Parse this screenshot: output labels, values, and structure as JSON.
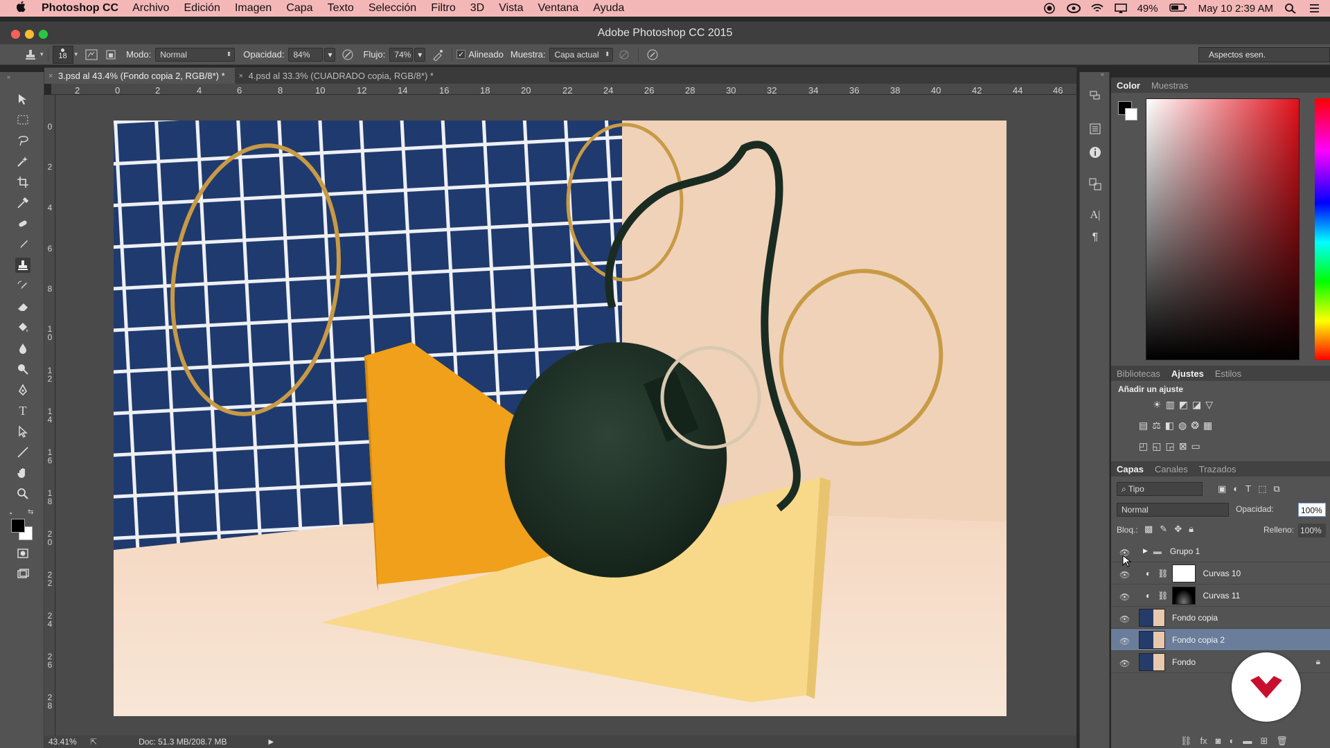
{
  "menubar": {
    "apple": "",
    "app_name": "Photoshop CC",
    "items": [
      "Archivo",
      "Edición",
      "Imagen",
      "Capa",
      "Texto",
      "Selección",
      "Filtro",
      "3D",
      "Vista",
      "Ventana",
      "Ayuda"
    ],
    "battery": "49%",
    "datetime": "May 10  2:39 AM"
  },
  "window": {
    "title": "Adobe Photoshop CC 2015"
  },
  "options": {
    "brush_size": "18",
    "mode_label": "Modo:",
    "mode_value": "Normal",
    "opacity_label": "Opacidad:",
    "opacity_value": "84%",
    "flow_label": "Flujo:",
    "flow_value": "74%",
    "aligned_label": "Alineado",
    "aligned_checked": true,
    "sample_label": "Muestra:",
    "sample_value": "Capa actual",
    "workspace": "Aspectos esen."
  },
  "tabs": [
    {
      "label": "3.psd al 43.4% (Fondo copia 2, RGB/8*) *",
      "close": "×"
    },
    {
      "label": "4.psd al 33.3% (CUADRADO copia, RGB/8*) *",
      "close": "×"
    }
  ],
  "ruler_top": [
    "2",
    "0",
    "2",
    "4",
    "6",
    "8",
    "10",
    "12",
    "14",
    "16",
    "18",
    "20",
    "22",
    "24",
    "26",
    "28",
    "30",
    "32",
    "34",
    "36",
    "38",
    "40",
    "42",
    "44",
    "46"
  ],
  "ruler_left": [
    "0",
    "2",
    "4",
    "6",
    "8",
    "1\n0",
    "1\n2",
    "1\n4",
    "1\n6",
    "1\n8",
    "2\n0",
    "2\n2",
    "2\n4",
    "2\n6",
    "2\n8"
  ],
  "status": {
    "zoom": "43.41%",
    "doc": "Doc: 51.3 MB/208.7 MB"
  },
  "color_panel": {
    "tabs": [
      "Color",
      "Muestras"
    ]
  },
  "adjust_panel": {
    "tabs": [
      "Bibliotecas",
      "Ajustes",
      "Estilos"
    ],
    "heading": "Añadir un ajuste"
  },
  "layers_panel": {
    "tabs": [
      "Capas",
      "Canales",
      "Trazados"
    ],
    "filter_value": "Tipo",
    "blend_value": "Normal",
    "opacity_label": "Opacidad:",
    "opacity_value": "100%",
    "lock_label": "Bloq.:",
    "fill_label": "Relleno:",
    "fill_value": "100%",
    "layers": [
      {
        "name": "Grupo 1",
        "kind": "group"
      },
      {
        "name": "Curvas 10",
        "kind": "adjustment"
      },
      {
        "name": "Curvas 11",
        "kind": "adjustment"
      },
      {
        "name": "Fondo copia",
        "kind": "image"
      },
      {
        "name": "Fondo copia 2",
        "kind": "image",
        "selected": true
      },
      {
        "name": "Fondo",
        "kind": "image",
        "locked": true
      }
    ]
  },
  "colors": {
    "menubar": "#f4b7b7",
    "panel_bg": "#535353",
    "selected_layer": "#6a7d9a",
    "brand_badge": "#c8102e"
  }
}
